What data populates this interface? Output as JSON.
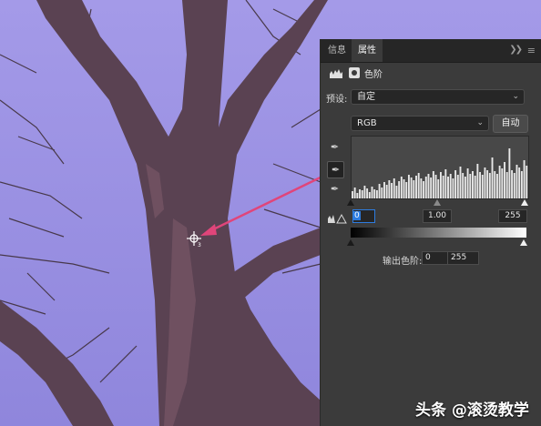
{
  "panel": {
    "tabs": [
      {
        "label": "信息",
        "active": false
      },
      {
        "label": "属性",
        "active": true
      }
    ],
    "collapse_icon": "double-chevron-right-icon",
    "menu_icon": "hamburger-menu-icon",
    "adjustment_title": "色阶",
    "preset_label": "预设:",
    "preset_value": "自定",
    "channel_value": "RGB",
    "auto_button": "自动",
    "input_black": "0",
    "input_gamma": "1.00",
    "input_white": "255",
    "output_label": "输出色阶:",
    "output_black": "0",
    "output_white": "255"
  },
  "watermark": "头条 @滚烫教学",
  "colors": {
    "panel_bg": "#3b3b3b",
    "arrow": "#e0457a",
    "sky": "#9a8fe0"
  }
}
